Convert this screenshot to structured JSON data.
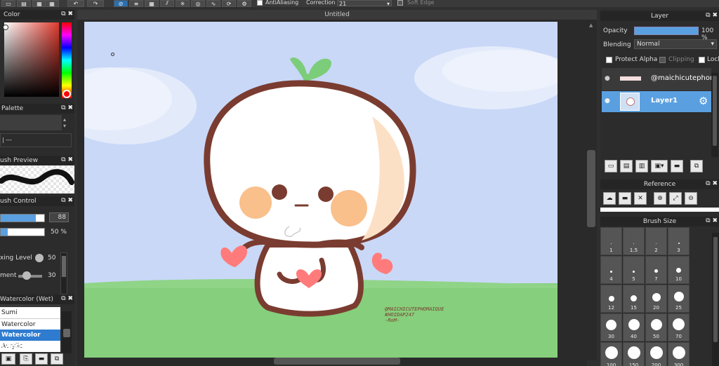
{
  "toolbar": {
    "antialiasing": "AntiAliasing",
    "correction_label": "Correction",
    "correction_value": "21",
    "soft_edge": "Soft Edge"
  },
  "document": {
    "tab_title": "Untitled"
  },
  "color_panel": {
    "title": "Color"
  },
  "palette_panel": {
    "title": "Palette",
    "row_text": "| ---"
  },
  "brush_preview_panel": {
    "title": "ush Preview"
  },
  "brush_control_panel": {
    "title": "ush Control",
    "size_value": "88",
    "opacity_value": "50 %",
    "mixing_label": "xing Level",
    "mixing_value": "50",
    "blend_label": "ment",
    "blend_value": "30"
  },
  "brush_list": {
    "title": "Watercolor (Wet)",
    "items": [
      "Sumi",
      "Watercolor",
      "Watercolor (Wet)",
      "Acrylic"
    ],
    "selected_index": 2
  },
  "layer_panel": {
    "title": "Layer",
    "opacity_label": "Opacity",
    "opacity_value": "100 %",
    "opacity_fraction": 1.0,
    "blending_label": "Blending",
    "blending_value": "Normal",
    "protect_alpha": "Protect Alpha",
    "clipping": "Clipping",
    "lock": "Lock",
    "layers": [
      {
        "name": "@maichicutephom",
        "selected": false
      },
      {
        "name": "Layer1",
        "selected": true
      }
    ]
  },
  "reference_panel": {
    "title": "Reference"
  },
  "brush_size_panel": {
    "title": "Brush Size",
    "sizes": [
      "1",
      "1.5",
      "2",
      "3",
      "4",
      "5",
      "7",
      "10",
      "12",
      "15",
      "20",
      "25",
      "30",
      "40",
      "50",
      "70",
      "100",
      "150",
      "200",
      "300"
    ]
  },
  "artwork": {
    "watermark_lines": [
      "@MAICHICUTEPHOMAIQUE",
      "#HOIDAP247",
      "-RoM-"
    ]
  },
  "colors": {
    "sky": "#c9d8f7",
    "grass": "#86cf7c",
    "outline": "#7a3c30",
    "cheek": "#f9c08c",
    "heart": "#ff7b7b",
    "sprout": "#7ccd7a",
    "selection": "#5aa0e0"
  }
}
